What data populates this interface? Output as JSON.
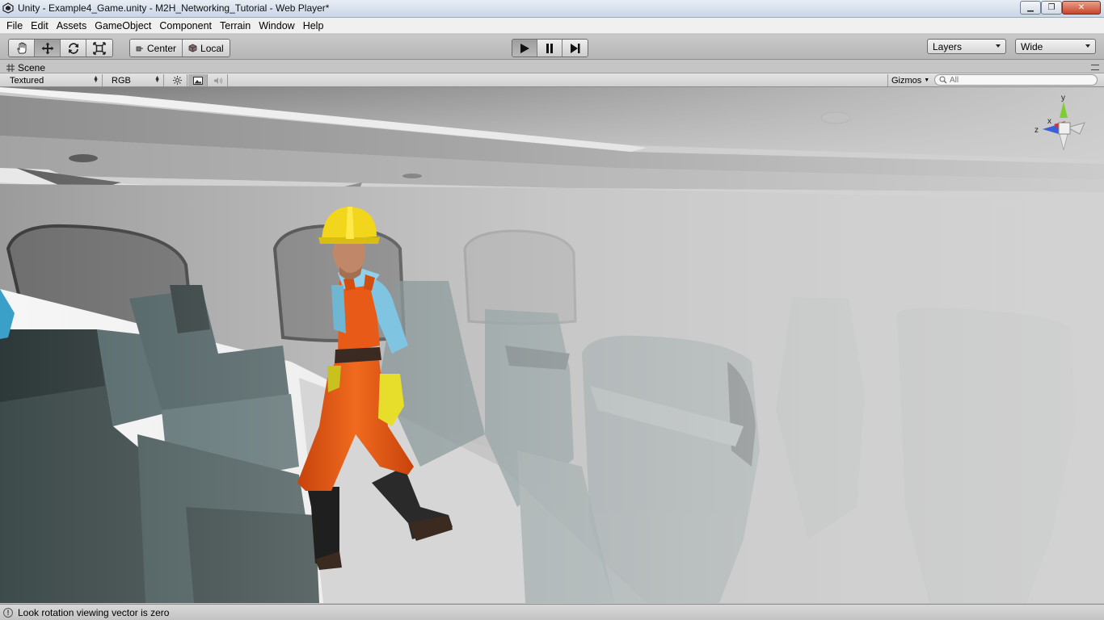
{
  "window": {
    "title": "Unity - Example4_Game.unity - M2H_Networking_Tutorial - Web Player*",
    "minimize_glyph": "▁",
    "maximize_glyph": "❐",
    "close_glyph": "✕"
  },
  "menu": {
    "items": [
      "File",
      "Edit",
      "Assets",
      "GameObject",
      "Component",
      "Terrain",
      "Window",
      "Help"
    ]
  },
  "toolbar": {
    "tools": [
      "hand-icon",
      "move-icon",
      "rotate-icon",
      "scale-icon"
    ],
    "active_tool": "move-icon",
    "pivot_mode": "Center",
    "pivot_rotation": "Local",
    "play_buttons": [
      "play-icon",
      "pause-icon",
      "step-icon"
    ],
    "layers_label": "Layers",
    "layout_label": "Wide"
  },
  "scene": {
    "tab_label": "Scene",
    "render_mode": "Textured",
    "channel": "RGB",
    "gizmos_label": "Gizmos",
    "search_placeholder": "All",
    "axis_labels": {
      "y": "y",
      "x": "x",
      "z": "z"
    }
  },
  "status": {
    "message": "Look rotation viewing vector is zero"
  },
  "colors": {
    "accent_active": "#9e9e9e",
    "gizmo_y": "#7ccf2f",
    "gizmo_x": "#d8342a",
    "gizmo_z": "#3b5fd6",
    "worker_overall": "#ea5a17",
    "worker_helmet": "#f2d61c",
    "worker_shirt": "#7fc4e0"
  }
}
